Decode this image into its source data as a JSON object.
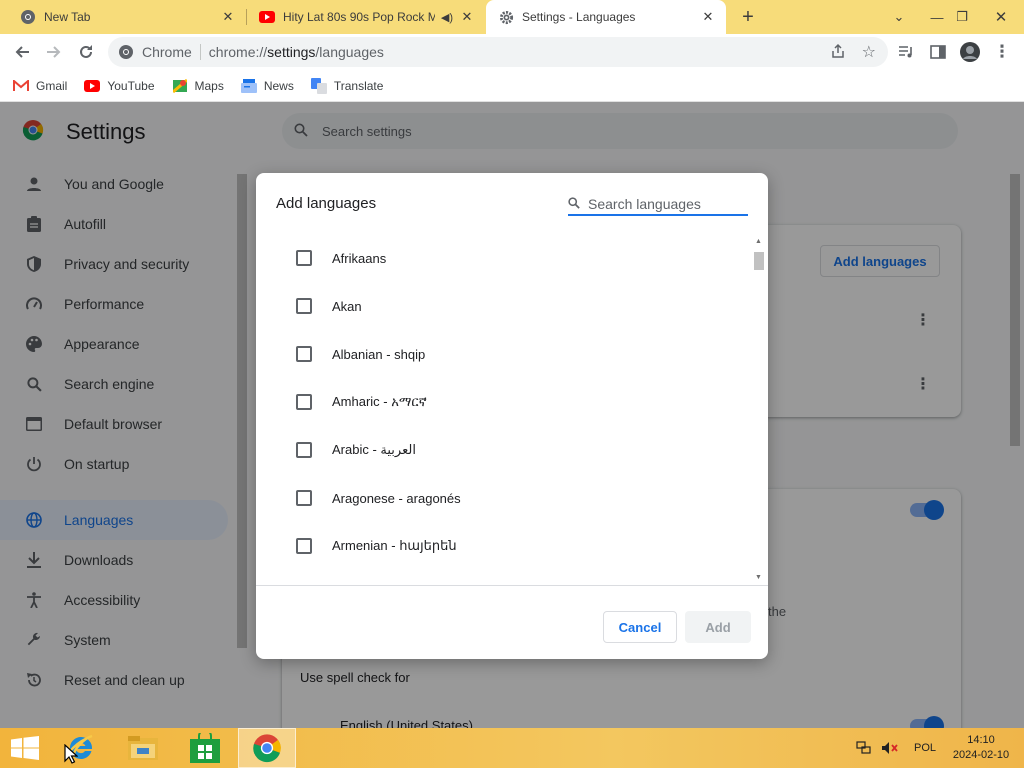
{
  "tabs": [
    {
      "title": "New Tab",
      "icon": "chrome-icon",
      "active": false
    },
    {
      "title": "Hity Lat 80s 90s Pop Rock M",
      "icon": "youtube-icon",
      "audio": true,
      "active": false
    },
    {
      "title": "Settings - Languages",
      "icon": "gear-icon",
      "active": true
    }
  ],
  "omnibox": {
    "site": "Chrome",
    "url_prefix": "chrome://",
    "url_host": "settings",
    "url_path": "/languages"
  },
  "bookmarks": [
    {
      "label": "Gmail",
      "icon": "gmail-icon"
    },
    {
      "label": "YouTube",
      "icon": "youtube-icon"
    },
    {
      "label": "Maps",
      "icon": "maps-icon"
    },
    {
      "label": "News",
      "icon": "news-icon"
    },
    {
      "label": "Translate",
      "icon": "translate-icon"
    }
  ],
  "settings": {
    "title": "Settings",
    "search_placeholder": "Search settings",
    "nav": [
      {
        "label": "You and Google",
        "icon": "person-icon"
      },
      {
        "label": "Autofill",
        "icon": "clipboard-icon"
      },
      {
        "label": "Privacy and security",
        "icon": "shield-icon"
      },
      {
        "label": "Performance",
        "icon": "speedometer-icon"
      },
      {
        "label": "Appearance",
        "icon": "palette-icon"
      },
      {
        "label": "Search engine",
        "icon": "search-icon"
      },
      {
        "label": "Default browser",
        "icon": "browser-icon"
      },
      {
        "label": "On startup",
        "icon": "power-icon"
      },
      {
        "label": "Languages",
        "icon": "globe-icon",
        "selected": true
      },
      {
        "label": "Downloads",
        "icon": "download-icon"
      },
      {
        "label": "Accessibility",
        "icon": "accessibility-icon"
      },
      {
        "label": "System",
        "icon": "wrench-icon"
      },
      {
        "label": "Reset and clean up",
        "icon": "reset-icon"
      }
    ],
    "add_languages_button": "Add languages",
    "spell_check_label": "Use spell check for",
    "spell_check_language": "English (United States)",
    "partial_text": "the"
  },
  "dialog": {
    "title": "Add languages",
    "search_placeholder": "Search languages",
    "languages": [
      "Afrikaans",
      "Akan",
      "Albanian - shqip",
      "Amharic - አማርኛ",
      "Arabic - العربية",
      "Aragonese - aragonés",
      "Armenian - հայերեն"
    ],
    "cancel_label": "Cancel",
    "add_label": "Add"
  },
  "taskbar": {
    "apps": [
      {
        "name": "Internet Explorer",
        "icon": "internet-explorer-icon"
      },
      {
        "name": "File Explorer",
        "icon": "file-explorer-icon"
      },
      {
        "name": "Store",
        "icon": "store-icon"
      },
      {
        "name": "Chrome",
        "icon": "chrome-icon",
        "active": true
      }
    ],
    "input_language": "POL",
    "time": "14:10",
    "date": "2024-02-10"
  },
  "colors": {
    "accent": "#1a73e8",
    "tabstrip": "#f7dc7a",
    "taskbar": "#f3c75f"
  }
}
